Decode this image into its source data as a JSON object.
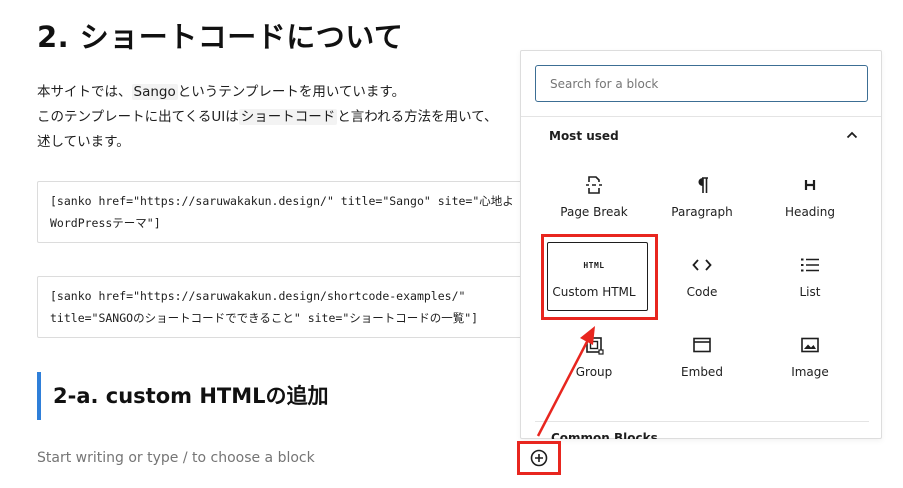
{
  "article": {
    "heading": "2. ショートコードについて",
    "paragraph": {
      "line1_pre": "本サイトでは、",
      "line1_hl": "Sango",
      "line1_post": "というテンプレートを用いています。",
      "line2_pre": "このテンプレートに出てくるUIは",
      "line2_hl": "ショートコード",
      "line2_post": "と言われる方法を用いて、",
      "line3": "述しています。"
    },
    "code1": {
      "line1": "[sanko href=\"https://saruwakakun.design/\" title=\"Sango\" site=\"心地よ",
      "line2": "WordPressテーマ\"]"
    },
    "code2": {
      "line1": "[sanko href=\"https://saruwakakun.design/shortcode-examples/\"",
      "line2": "title=\"SANGOのショートコードでできること\" site=\"ショートコードの一覧\"]"
    },
    "subheading": "2-a. custom HTMLの追加",
    "placeholder": "Start writing or type / to choose a block"
  },
  "inserter": {
    "search_placeholder": "Search for a block",
    "section_title": "Most used",
    "blocks": [
      {
        "label": "Page Break",
        "icon": "page-break-icon"
      },
      {
        "label": "Paragraph",
        "icon": "paragraph-icon"
      },
      {
        "label": "Heading",
        "icon": "heading-icon"
      },
      {
        "label": "Custom HTML",
        "icon": "html-icon",
        "icon_text": "HTML"
      },
      {
        "label": "Code",
        "icon": "code-icon"
      },
      {
        "label": "List",
        "icon": "list-icon"
      },
      {
        "label": "Group",
        "icon": "group-icon"
      },
      {
        "label": "Embed",
        "icon": "embed-icon"
      },
      {
        "label": "Image",
        "icon": "image-icon"
      }
    ],
    "next_section_partial": "Common Blocks"
  },
  "colors": {
    "annotation_red": "#e8261f",
    "heading_accent": "#2f7fd9",
    "search_border": "#3c6e94"
  }
}
